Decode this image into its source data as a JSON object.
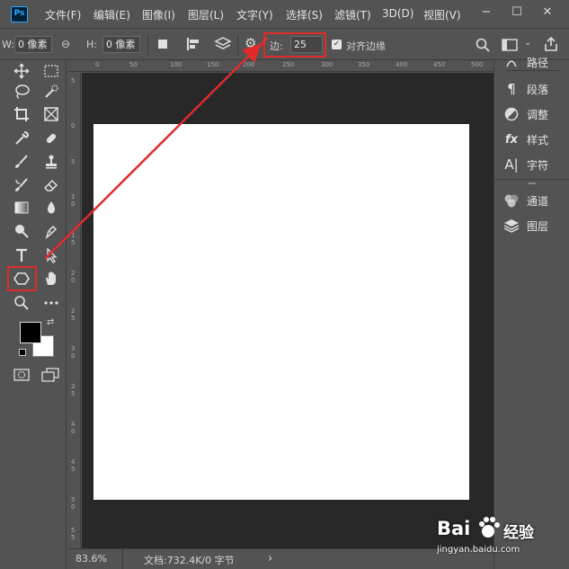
{
  "app": {
    "logo": "Ps"
  },
  "menu": [
    "文件(F)",
    "编辑(E)",
    "图像(I)",
    "图层(L)",
    "文字(Y)",
    "选择(S)",
    "滤镜(T)",
    "3D(D)",
    "视图(V)"
  ],
  "window_controls": {
    "minimize": "−",
    "maximize": "☐",
    "close": "✕"
  },
  "options": {
    "w_label": "W:",
    "w_value": "0 像素",
    "h_label": "H:",
    "h_value": "0 像素",
    "sides_label": "边:",
    "sides_value": "25",
    "align_edges_label": "对齐边缘",
    "align_edges_checked": true
  },
  "ruler_top": [
    "0",
    "50",
    "100",
    "150",
    "200",
    "250",
    "300",
    "350",
    "400",
    "450",
    "500"
  ],
  "ruler_left": [
    "5",
    "0",
    "5",
    "1 0",
    "1 5",
    "2 0",
    "2 5",
    "3 0",
    "3 5",
    "4 0",
    "4 5",
    "5 0",
    "5 5"
  ],
  "status": {
    "zoom": "83.6%",
    "doc": "文档:732.4K/0 字节",
    "arrow": "›"
  },
  "panels": [
    {
      "icon": "paths-icon",
      "label": "路径"
    },
    {
      "icon": "paragraph-icon",
      "label": "段落"
    },
    {
      "icon": "adjustments-icon",
      "label": "调整"
    },
    {
      "icon": "styles-icon",
      "label": "样式"
    },
    {
      "icon": "character-icon",
      "label": "字符"
    },
    {
      "icon": "channels-icon",
      "label": "通道"
    },
    {
      "icon": "layers-icon",
      "label": "图层"
    }
  ],
  "watermark": {
    "brand": "Bai",
    "brand2": "经验",
    "url": "jingyan.baidu.com"
  },
  "colors": {
    "highlight": "#e12b2b",
    "accent": "#31a8ff",
    "canvas_bg": "#282828"
  }
}
